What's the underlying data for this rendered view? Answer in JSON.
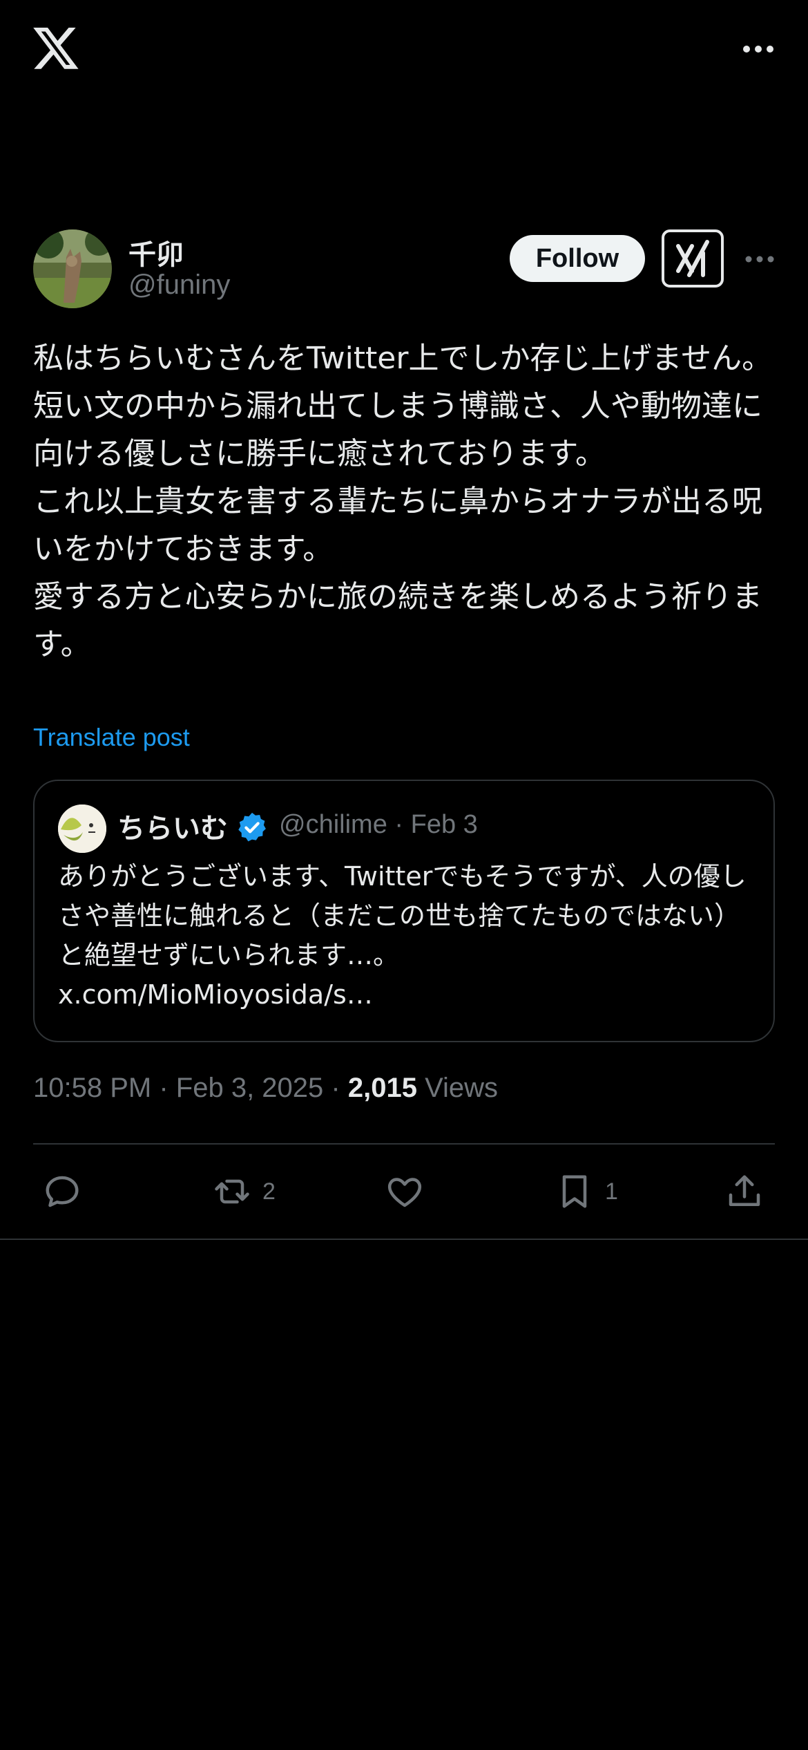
{
  "app": {
    "logo": "x-logo-icon"
  },
  "author": {
    "name": "千卯",
    "handle": "@funiny",
    "follow_label": "Follow"
  },
  "post": {
    "text": "私はちらいむさんをTwitter上でしか存じ上げません。\n短い文の中から漏れ出てしまう博識さ、人や動物達に向ける優しさに勝手に癒されております。\nこれ以上貴女を害する輩たちに鼻からオナラが出る呪いをかけておきます。\n愛する方と心安らかに旅の続きを楽しめるよう祈ります。",
    "translate_label": "Translate post",
    "time": "10:58 PM",
    "date": "Feb 3, 2025",
    "views_count": "2,015",
    "views_label": "Views"
  },
  "quote": {
    "name": "ちらいむ",
    "handle": "@chilime",
    "date": "Feb 3",
    "text": "ありがとうございます、Twitterでもそうですが、人の優しさや善性に触れると（まだこの世も捨てたものではない）と絶望せずにいられます…。\nx.com/MioMioyosida/s…"
  },
  "actions": {
    "reply_count": "",
    "repost_count": "2",
    "like_count": "",
    "bookmark_count": "1"
  },
  "colors": {
    "background": "#000000",
    "text": "#e7e9ea",
    "muted": "#71767b",
    "accent": "#1d9bf0",
    "border": "#2f3336"
  }
}
